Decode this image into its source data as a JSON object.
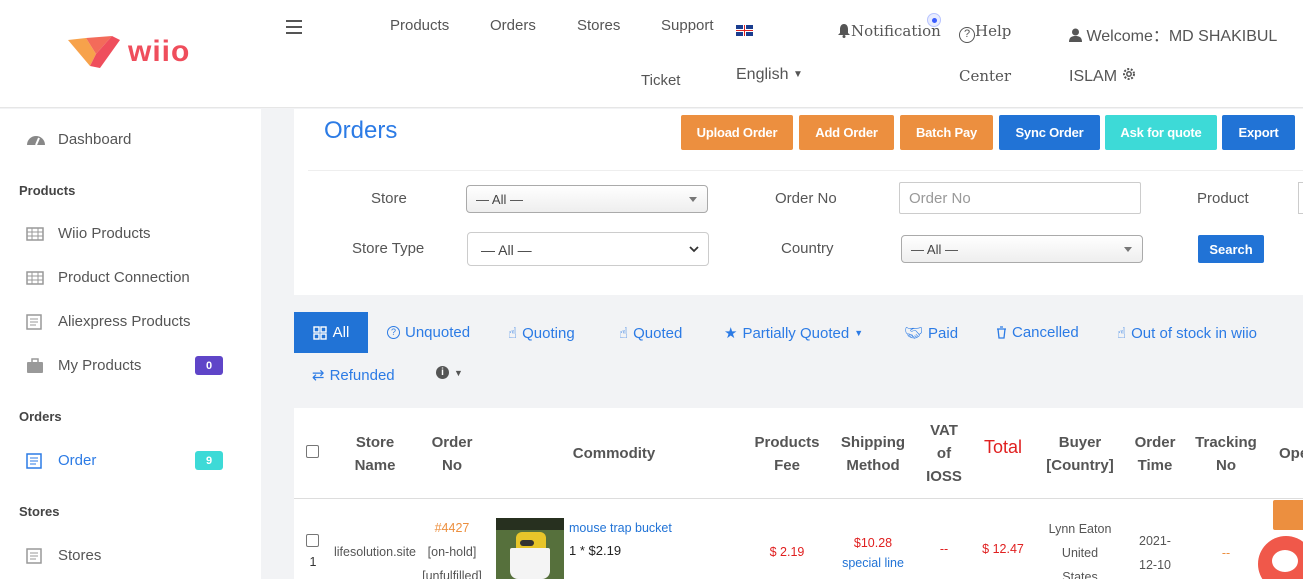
{
  "header": {
    "logo": "wiio",
    "nav": {
      "products": "Products",
      "orders": "Orders",
      "stores": "Stores",
      "support": "Support",
      "ticket": "Ticket",
      "language": "English",
      "notification": "Notification",
      "help": "Help",
      "center": "Center",
      "welcome": "Welcome：MD SHAKIBUL",
      "user_last": "ISLAM"
    }
  },
  "sidebar": {
    "dashboard": "Dashboard",
    "sec_products": "Products",
    "wiio_products": "Wiio Products",
    "product_connection": "Product Connection",
    "aliexpress_products": "Aliexpress Products",
    "my_products": "My Products",
    "my_products_count": "0",
    "sec_orders": "Orders",
    "order": "Order",
    "order_count": "9",
    "sec_stores": "Stores",
    "stores": "Stores"
  },
  "page": {
    "title": "Orders",
    "buttons": {
      "upload": "Upload Order",
      "add": "Add Order",
      "batch": "Batch Pay",
      "sync": "Sync Order",
      "quote": "Ask for quote",
      "export": "Export"
    },
    "filters": {
      "store_label": "Store",
      "store_value": "— All —",
      "order_no_label": "Order No",
      "order_no_placeholder": "Order No",
      "product_label": "Product",
      "store_type_label": "Store Type",
      "store_type_value": "— All —",
      "country_label": "Country",
      "country_value": "— All —",
      "search": "Search"
    }
  },
  "tabs": {
    "all": "All",
    "unquoted": "Unquoted",
    "quoting": "Quoting",
    "quoted": "Quoted",
    "partially_quoted": "Partially Quoted",
    "paid": "Paid",
    "cancelled": "Cancelled",
    "out_of_stock": "Out of stock in wiio",
    "refunded": "Refunded"
  },
  "table": {
    "headers": {
      "store_name": [
        "Store",
        "Name"
      ],
      "order_no": [
        "Order",
        "No"
      ],
      "commodity": "Commodity",
      "products_fee": [
        "Products",
        "Fee"
      ],
      "shipping": [
        "Shipping",
        "Method"
      ],
      "vat": [
        "VAT",
        "of",
        "IOSS"
      ],
      "total": "Total",
      "buyer": [
        "Buyer",
        "[Country]"
      ],
      "order_time": [
        "Order",
        "Time"
      ],
      "tracking": [
        "Tracking",
        "No"
      ],
      "op": "Ope"
    },
    "row": {
      "index": "1",
      "store": "lifesolution.site",
      "order_no": "#4427",
      "status1": "[on-hold]",
      "status2": "[unfulfilled]",
      "product": "mouse trap bucket",
      "qty_price": "1 * $2.19",
      "fee": "$ 2.19",
      "shipping_price": "$10.28",
      "shipping_method": "special line",
      "vat": "--",
      "total": "$ 12.47",
      "buyer": "Lynn Eaton",
      "country1": "United",
      "country2": "States",
      "time1": "2021-",
      "time2": "12-10",
      "tracking": "--"
    }
  },
  "colors": {
    "orange": "#ec8f3f",
    "blue": "#2173d6",
    "teal": "#3ddad7",
    "purple": "#5f45c8",
    "link": "#2c7be5",
    "red": "#e02020"
  }
}
